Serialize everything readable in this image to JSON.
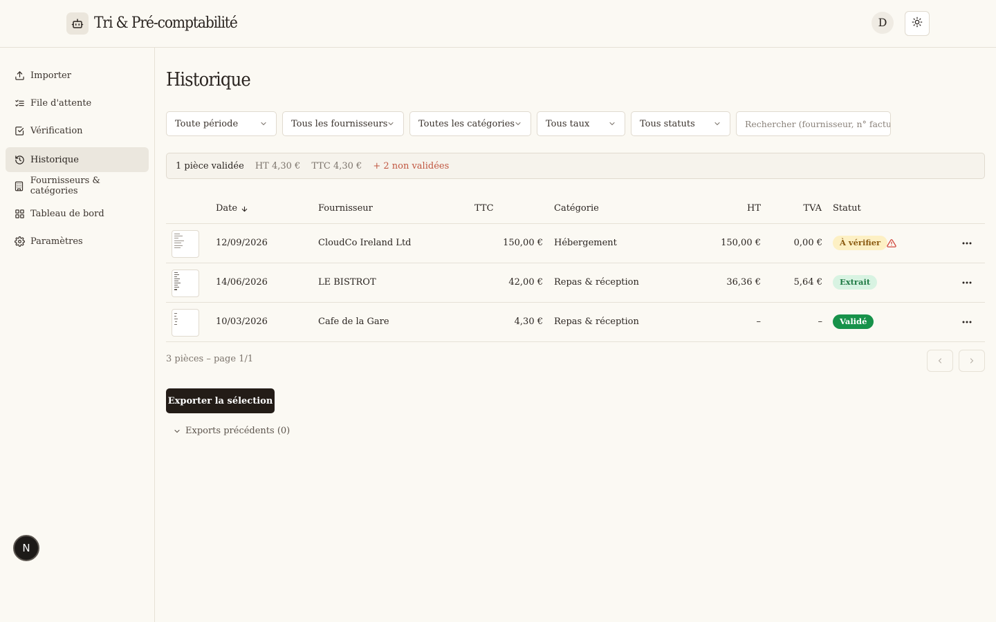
{
  "header": {
    "app_title": "Tri & Pré-comptabilité",
    "avatar_initial": "D",
    "logo_icon": "robot-icon",
    "theme_icon": "sun-icon"
  },
  "sidebar": {
    "items": [
      {
        "label": "Importer",
        "icon": "upload-icon",
        "active": false
      },
      {
        "label": "File d'attente",
        "icon": "list-check-icon",
        "active": false
      },
      {
        "label": "Vérification",
        "icon": "checkbox-icon",
        "active": false
      },
      {
        "label": "Historique",
        "icon": "history-icon",
        "active": true
      },
      {
        "label": "Fournisseurs & catégories",
        "icon": "building-icon",
        "active": false
      },
      {
        "label": "Tableau de bord",
        "icon": "dashboard-icon",
        "active": false
      },
      {
        "label": "Paramètres",
        "icon": "gear-icon",
        "active": false
      }
    ],
    "badge": "N"
  },
  "main": {
    "title": "Historique",
    "filters": {
      "period": "Toute période",
      "suppliers": "Tous les fournisseurs",
      "categories": "Toutes les catégories",
      "rates": "Tous taux",
      "statuses": "Tous statuts"
    },
    "search_placeholder": "Rechercher (fournisseur, n° facture…)",
    "summary": {
      "validated": "1 pièce validée",
      "ht": "HT 4,30 €",
      "ttc": "TTC 4,30 €",
      "not_validated": "+ 2 non validées"
    },
    "table": {
      "headers": {
        "date": "Date",
        "supplier": "Fournisseur",
        "ttc": "TTC",
        "category": "Catégorie",
        "ht": "HT",
        "tva": "TVA",
        "status": "Statut"
      },
      "rows": [
        {
          "date": "12/09/2026",
          "supplier": "CloudCo Ireland Ltd",
          "ttc": "150,00 €",
          "category": "Hébergement",
          "ht": "150,00 €",
          "tva": "0,00 €",
          "status": "À vérifier",
          "status_type": "verify",
          "warning": true
        },
        {
          "date": "14/06/2026",
          "supplier": "LE BISTROT",
          "ttc": "42,00 €",
          "category": "Repas & réception",
          "ht": "36,36 €",
          "tva": "5,64 €",
          "status": "Extrait",
          "status_type": "extract",
          "warning": false
        },
        {
          "date": "10/03/2026",
          "supplier": "Cafe de la Gare",
          "ttc": "4,30 €",
          "category": "Repas & réception",
          "ht": "–",
          "tva": "–",
          "status": "Validé",
          "status_type": "valid",
          "warning": false
        }
      ]
    },
    "footer": {
      "count": "3 pièces – page 1/1"
    },
    "export_button": "Exporter la sélection",
    "previous_exports": "Exports précédents (0)"
  },
  "colors": {
    "background": "#fbf9f3",
    "primary": "#231c17",
    "valid": "#17924a",
    "warning": "#c0553f"
  }
}
